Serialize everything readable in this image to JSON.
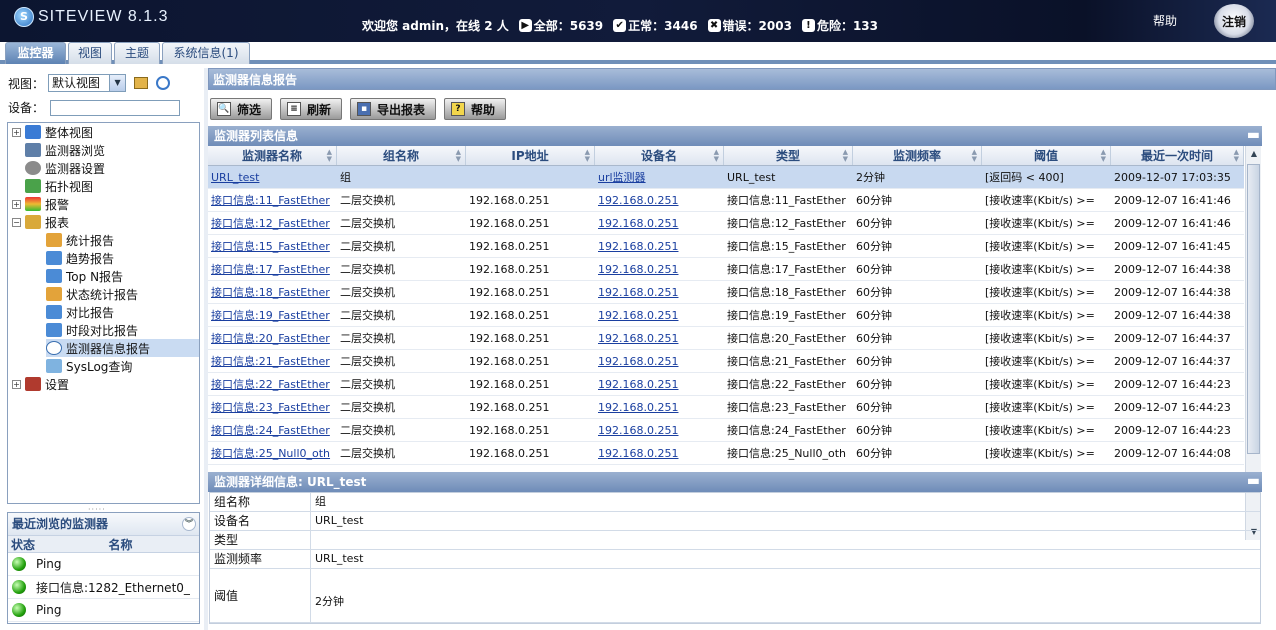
{
  "app": {
    "name": "SITEVIEW 8.1.3"
  },
  "header": {
    "welcome_prefix": "欢迎您 admin，在线 2 人",
    "total_label": "全部：5639",
    "ok_label": "正常：3446",
    "error_label": "错误：2003",
    "danger_label": "危险：133",
    "help": "帮助",
    "logout": "注销"
  },
  "tabs": [
    {
      "label": "监控器"
    },
    {
      "label": "视图"
    },
    {
      "label": "主题"
    },
    {
      "label": "系统信息(1)"
    }
  ],
  "left": {
    "view_label": "视图：",
    "view_value": "默认视图",
    "device_label": "设备："
  },
  "tree": [
    {
      "label": "整体视图",
      "exp": "+"
    },
    {
      "label": "监测器浏览",
      "exp": ""
    },
    {
      "label": "监测器设置",
      "exp": ""
    },
    {
      "label": "拓扑视图",
      "exp": ""
    },
    {
      "label": "报警",
      "exp": "+"
    },
    {
      "label": "报表",
      "exp": "−"
    },
    {
      "label": "统计报告",
      "exp": ""
    },
    {
      "label": "趋势报告",
      "exp": ""
    },
    {
      "label": "Top N报告",
      "exp": ""
    },
    {
      "label": "状态统计报告",
      "exp": ""
    },
    {
      "label": "对比报告",
      "exp": ""
    },
    {
      "label": "时段对比报告",
      "exp": ""
    },
    {
      "label": "监测器信息报告",
      "exp": ""
    },
    {
      "label": "SysLog查询",
      "exp": ""
    },
    {
      "label": "设置",
      "exp": "+"
    }
  ],
  "recent": {
    "title": "最近浏览的监测器",
    "col_status": "状态",
    "col_name": "名称",
    "items": [
      "Ping",
      "接口信息:1282_Ethernet0_",
      "Ping"
    ]
  },
  "main": {
    "title": "监测器信息报告",
    "buttons": {
      "filter": "筛选",
      "refresh": "刷新",
      "export": "导出报表",
      "help": "帮助"
    },
    "list_title": "监测器列表信息",
    "columns": [
      "监测器名称",
      "组名称",
      "IP地址",
      "设备名",
      "类型",
      "监测频率",
      "阈值",
      "最近一次时间"
    ],
    "rows": [
      [
        "URL_test",
        "组",
        "",
        "url监测器",
        "URL_test",
        "2分钟",
        "[返回码 < 400]",
        "2009-12-07 17:03:35"
      ],
      [
        "接口信息:11_FastEther",
        "二层交换机",
        "192.168.0.251",
        "192.168.0.251",
        "接口信息:11_FastEther",
        "60分钟",
        "[接收速率(Kbit/s) >=",
        "2009-12-07 16:41:46"
      ],
      [
        "接口信息:12_FastEther",
        "二层交换机",
        "192.168.0.251",
        "192.168.0.251",
        "接口信息:12_FastEther",
        "60分钟",
        "[接收速率(Kbit/s) >=",
        "2009-12-07 16:41:46"
      ],
      [
        "接口信息:15_FastEther",
        "二层交换机",
        "192.168.0.251",
        "192.168.0.251",
        "接口信息:15_FastEther",
        "60分钟",
        "[接收速率(Kbit/s) >=",
        "2009-12-07 16:41:45"
      ],
      [
        "接口信息:17_FastEther",
        "二层交换机",
        "192.168.0.251",
        "192.168.0.251",
        "接口信息:17_FastEther",
        "60分钟",
        "[接收速率(Kbit/s) >=",
        "2009-12-07 16:44:38"
      ],
      [
        "接口信息:18_FastEther",
        "二层交换机",
        "192.168.0.251",
        "192.168.0.251",
        "接口信息:18_FastEther",
        "60分钟",
        "[接收速率(Kbit/s) >=",
        "2009-12-07 16:44:38"
      ],
      [
        "接口信息:19_FastEther",
        "二层交换机",
        "192.168.0.251",
        "192.168.0.251",
        "接口信息:19_FastEther",
        "60分钟",
        "[接收速率(Kbit/s) >=",
        "2009-12-07 16:44:38"
      ],
      [
        "接口信息:20_FastEther",
        "二层交换机",
        "192.168.0.251",
        "192.168.0.251",
        "接口信息:20_FastEther",
        "60分钟",
        "[接收速率(Kbit/s) >=",
        "2009-12-07 16:44:37"
      ],
      [
        "接口信息:21_FastEther",
        "二层交换机",
        "192.168.0.251",
        "192.168.0.251",
        "接口信息:21_FastEther",
        "60分钟",
        "[接收速率(Kbit/s) >=",
        "2009-12-07 16:44:37"
      ],
      [
        "接口信息:22_FastEther",
        "二层交换机",
        "192.168.0.251",
        "192.168.0.251",
        "接口信息:22_FastEther",
        "60分钟",
        "[接收速率(Kbit/s) >=",
        "2009-12-07 16:44:23"
      ],
      [
        "接口信息:23_FastEther",
        "二层交换机",
        "192.168.0.251",
        "192.168.0.251",
        "接口信息:23_FastEther",
        "60分钟",
        "[接收速率(Kbit/s) >=",
        "2009-12-07 16:44:23"
      ],
      [
        "接口信息:24_FastEther",
        "二层交换机",
        "192.168.0.251",
        "192.168.0.251",
        "接口信息:24_FastEther",
        "60分钟",
        "[接收速率(Kbit/s) >=",
        "2009-12-07 16:44:23"
      ],
      [
        "接口信息:25_Null0_oth",
        "二层交换机",
        "192.168.0.251",
        "192.168.0.251",
        "接口信息:25_Null0_oth",
        "60分钟",
        "[接收速率(Kbit/s) >=",
        "2009-12-07 16:44:08"
      ]
    ],
    "detail_title": "监测器详细信息: URL_test",
    "detail": [
      {
        "label": "组名称",
        "value": "组"
      },
      {
        "label": "设备名",
        "value": "URL_test"
      },
      {
        "label": "类型",
        "value": ""
      },
      {
        "label": "监测频率",
        "value": "URL_test"
      },
      {
        "label": "阈值",
        "value": "2分钟"
      }
    ]
  }
}
